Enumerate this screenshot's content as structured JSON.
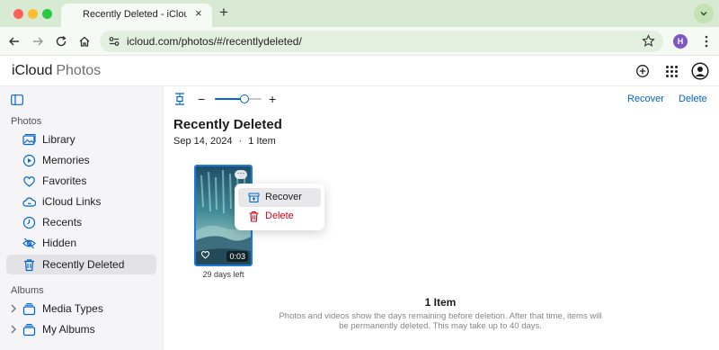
{
  "browser": {
    "tab_title": "Recently Deleted - iCloud Photos",
    "new_tab_symbol": "+",
    "url": "icloud.com/photos/#/recentlydeleted/",
    "profile_initial": "H"
  },
  "app": {
    "brand_apple": "",
    "brand_icloud": "iCloud",
    "brand_photos": "Photos"
  },
  "sidebar": {
    "photos_section": "Photos",
    "items": [
      {
        "label": "Library",
        "icon": "photo-library-icon"
      },
      {
        "label": "Memories",
        "icon": "memories-icon"
      },
      {
        "label": "Favorites",
        "icon": "heart-icon"
      },
      {
        "label": "iCloud Links",
        "icon": "cloud-link-icon"
      },
      {
        "label": "Recents",
        "icon": "clock-icon"
      },
      {
        "label": "Hidden",
        "icon": "eye-slash-icon"
      },
      {
        "label": "Recently Deleted",
        "icon": "trash-icon",
        "selected": true
      }
    ],
    "albums_section": "Albums",
    "albums": [
      {
        "label": "Media Types",
        "icon": "stack-icon"
      },
      {
        "label": "My Albums",
        "icon": "stack-icon"
      }
    ]
  },
  "toolbar": {
    "zoom_minus": "−",
    "zoom_plus": "+",
    "zoom_level": 0.63,
    "recover_label": "Recover",
    "delete_label": "Delete"
  },
  "page": {
    "title": "Recently Deleted",
    "date": "Sep 14, 2024",
    "separator": "·",
    "count": "1 Item"
  },
  "thumbnail": {
    "duration": "0:03",
    "days_left": "29 days left",
    "more_symbol": "···"
  },
  "context_menu": {
    "recover": "Recover",
    "delete": "Delete"
  },
  "empty_state": {
    "title": "1 Item",
    "description": "Photos and videos show the days remaining before deletion. After that time, items will be permanently deleted. This may take up to 40 days."
  },
  "colors": {
    "accent": "#0066cc",
    "selection": "#1f7ae0",
    "danger": "#d70015",
    "sidebar_selected": "#e3e3e6"
  }
}
